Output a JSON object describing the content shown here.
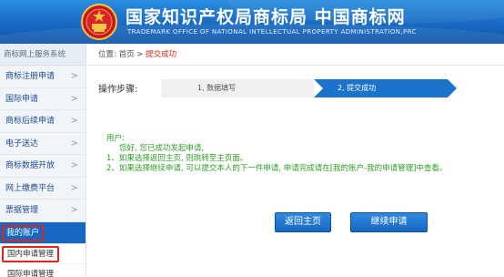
{
  "header": {
    "title": "国家知识产权局商标局 中国商标网",
    "subtitle": "TRADEMARK OFFICE OF NATIONAL INTELLECTUAL PROPERTY ADMINISTRATION,PRC",
    "emblem_icon": "national-emblem-icon"
  },
  "sidebar": {
    "title": "商标网上服务系统",
    "items": [
      {
        "label": "商标注册申请"
      },
      {
        "label": "国际申请"
      },
      {
        "label": "商标后续申请"
      },
      {
        "label": "电子送达"
      },
      {
        "label": "商标数据开放"
      },
      {
        "label": "网上缴费平台"
      },
      {
        "label": "票据管理"
      },
      {
        "label": "我的账户"
      }
    ],
    "arrow": ">",
    "sub_items": [
      {
        "label": "国内申请管理"
      },
      {
        "label": "国际申请管理"
      }
    ]
  },
  "breadcrumb": {
    "prefix": "位置:",
    "home": "首页",
    "sep": ">",
    "current": "提交成功"
  },
  "steps": {
    "label": "操作步骤:",
    "step1": "1, 数据填写",
    "step2": "2, 提交成功"
  },
  "message": {
    "user": "用户:",
    "line1": "您好, 您已成功发起申请,",
    "line2": "1、如果选择返回主页, 则跳转至主页面。",
    "line3": "2、如果选择继续申请, 可以提交本人的下一件申请, 申请完成请在[我的账户-我的申请管理]中查看。"
  },
  "buttons": {
    "home": "返回主页",
    "continue": "继续申请"
  },
  "colors": {
    "brand_blue": "#1667bf",
    "success_green": "#2f9e26",
    "highlight_red": "#e0241b"
  }
}
